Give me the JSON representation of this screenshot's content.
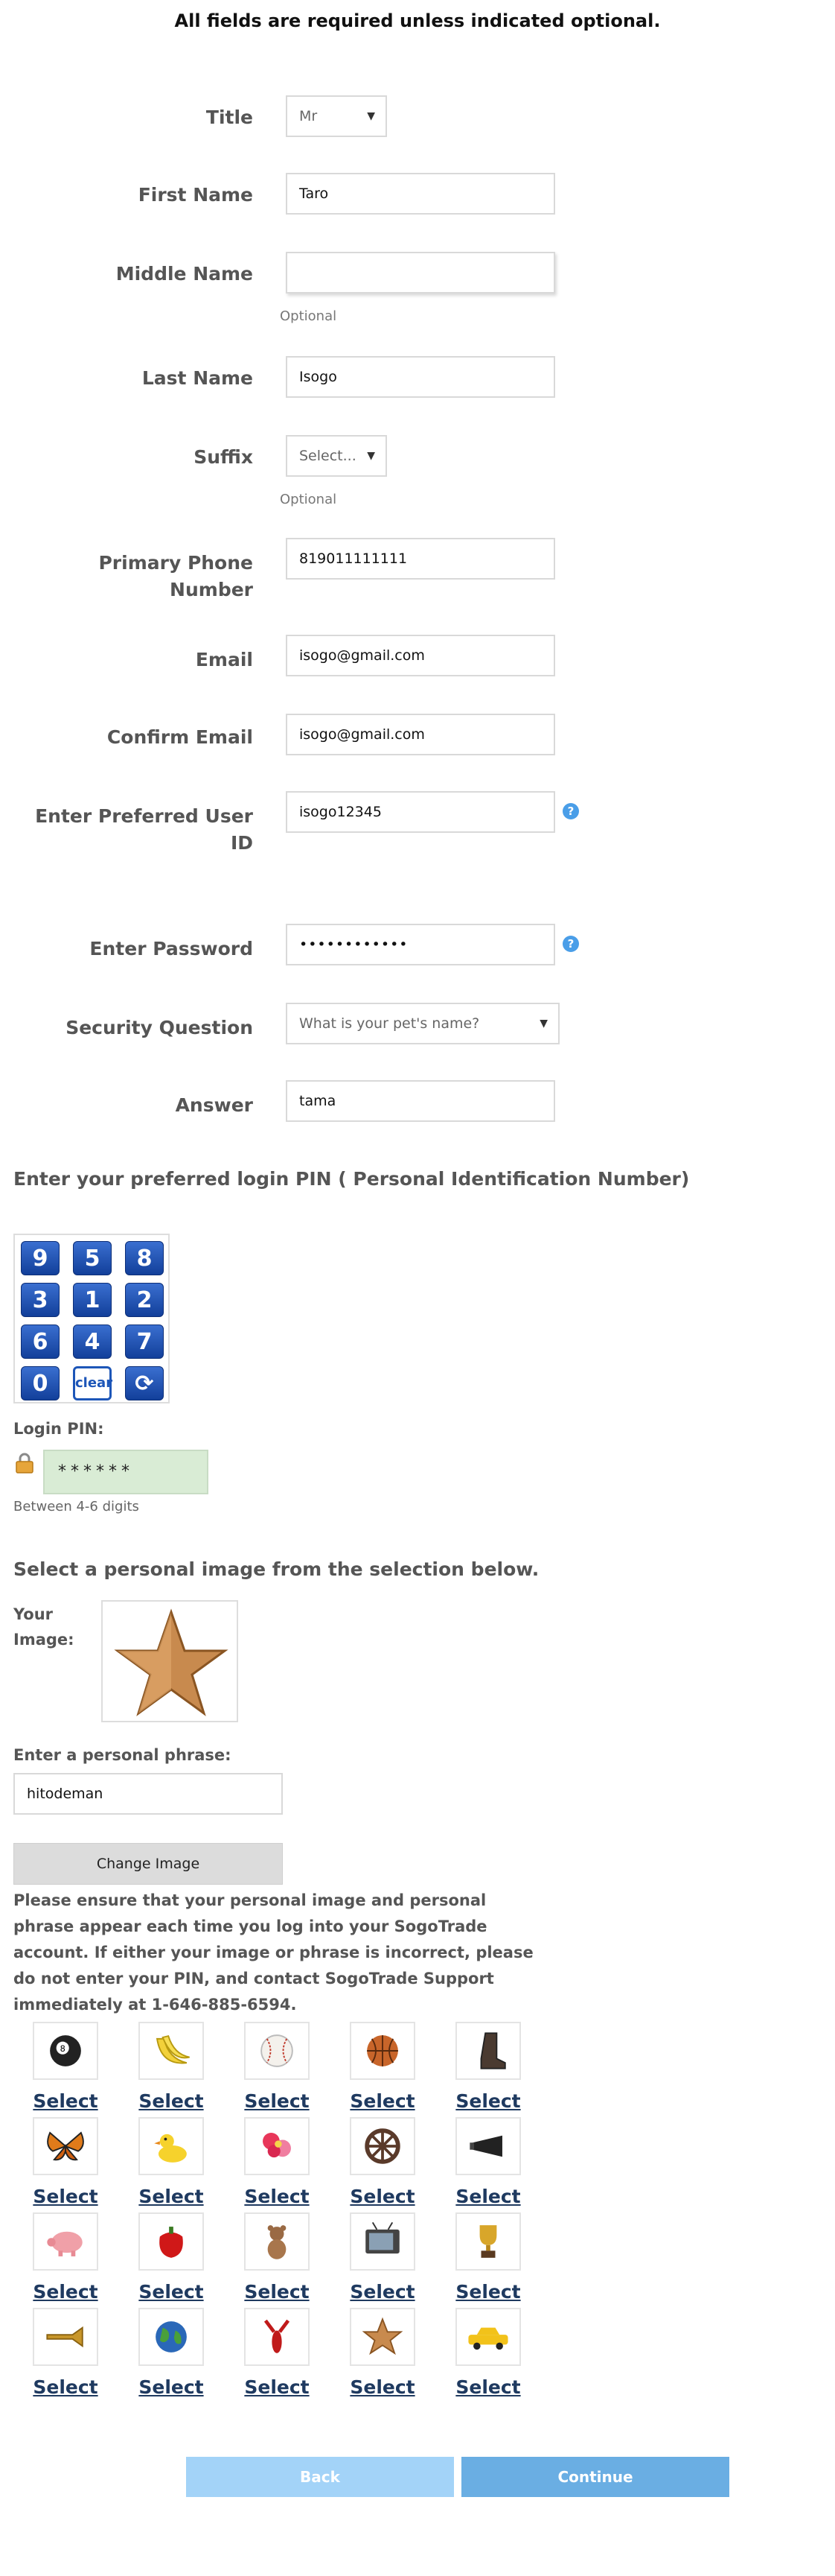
{
  "notice": "All fields are required unless indicated optional.",
  "fields": {
    "title": {
      "label": "Title",
      "value": "Mr"
    },
    "first_name": {
      "label": "First Name",
      "value": "Taro"
    },
    "middle_name": {
      "label": "Middle Name",
      "value": "",
      "note": "Optional"
    },
    "last_name": {
      "label": "Last Name",
      "value": "Isogo"
    },
    "suffix": {
      "label": "Suffix",
      "value": "Select...",
      "note": "Optional"
    },
    "phone": {
      "label_line1": "Primary Phone",
      "label_line2": "Number",
      "value": "819011111111"
    },
    "email": {
      "label": "Email",
      "value": "isogo@gmail.com"
    },
    "confirm_email": {
      "label": "Confirm Email",
      "value": "isogo@gmail.com"
    },
    "user_id": {
      "label_line1": "Enter Preferred User",
      "label_line2": "ID",
      "value": "isogo12345"
    },
    "password": {
      "label": "Enter Password",
      "value": "••••••••••••"
    },
    "security_question": {
      "label": "Security Question",
      "value": "What is your pet's name?"
    },
    "answer": {
      "label": "Answer",
      "value": "tama"
    }
  },
  "help_glyph": "?",
  "pin": {
    "heading": "Enter your preferred login PIN ( Personal Identification Number)",
    "keys": [
      "9",
      "5",
      "8",
      "3",
      "1",
      "2",
      "6",
      "4",
      "7",
      "0"
    ],
    "clear_label": "clear",
    "refresh_glyph": "⟳",
    "label": "Login PIN:",
    "value": "******",
    "hint": "Between 4-6 digits"
  },
  "image": {
    "heading": "Select a personal image from the selection below.",
    "your_image_line1": "Your",
    "your_image_line2": "Image:",
    "selected": "star-icon"
  },
  "phrase": {
    "label": "Enter a personal phrase:",
    "value": "hitodeman"
  },
  "change_image_label": "Change Image",
  "notice_paragraph": "Please ensure that your personal image and personal phrase appear each time you log into your SogoTrade account. If either your image or phrase is incorrect, please do not enter your PIN, and contact SogoTrade Support immediately at 1-646-885-6594.",
  "gallery": {
    "select_label": "Select",
    "images": [
      "eight-ball-icon",
      "banana-icon",
      "baseball-icon",
      "basketball-icon",
      "cowboy-boot-icon",
      "butterfly-icon",
      "rubber-duck-icon",
      "flower-icon",
      "film-reel-icon",
      "megaphone-icon",
      "piggy-bank-icon",
      "pepper-icon",
      "teddy-bear-icon",
      "television-icon",
      "trophy-icon",
      "trumpet-icon",
      "globe-icon",
      "lobster-icon",
      "star-icon",
      "taxi-icon"
    ]
  },
  "buttons": {
    "back": "Back",
    "continue": "Continue"
  },
  "colors": {
    "back": "#a3d3f8",
    "continue": "#6aaee3",
    "help": "#4a9ee8",
    "pin_box": "#d9ecd5"
  }
}
